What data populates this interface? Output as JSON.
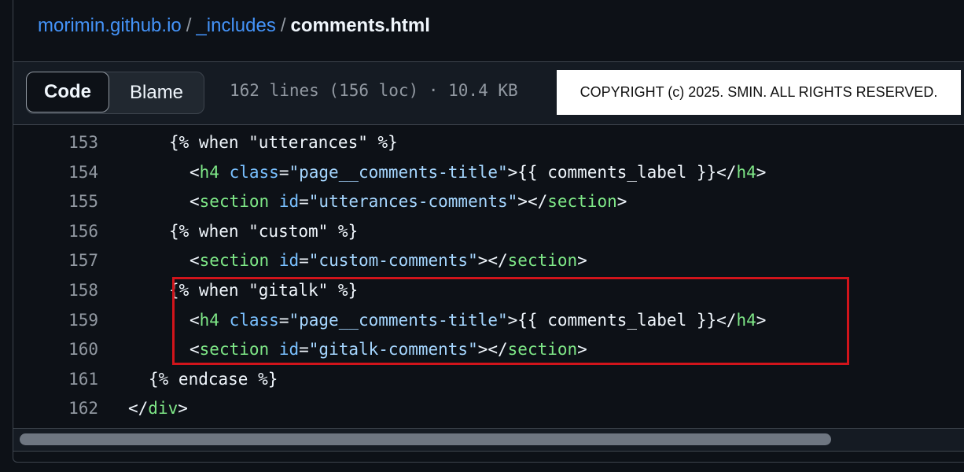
{
  "breadcrumb": {
    "repo": "morimin.github.io",
    "sep1": "/",
    "folder": "_includes",
    "sep2": "/",
    "file": "comments.html"
  },
  "toolbar": {
    "code_label": "Code",
    "blame_label": "Blame",
    "file_info": "162 lines (156 loc) · 10.4 KB"
  },
  "copyright": "COPYRIGHT (c) 2025. SMIN. ALL RIGHTS RESERVED.",
  "code": {
    "lines": [
      {
        "num": "153",
        "indent": 6,
        "tokens": [
          {
            "t": "punc",
            "v": "{% when \"utterances\" %}"
          }
        ]
      },
      {
        "num": "154",
        "indent": 8,
        "tokens": [
          {
            "t": "punc",
            "v": "<"
          },
          {
            "t": "tag",
            "v": "h4"
          },
          {
            "t": "punc",
            "v": " "
          },
          {
            "t": "attr",
            "v": "class"
          },
          {
            "t": "punc",
            "v": "="
          },
          {
            "t": "str",
            "v": "\"page__comments-title\""
          },
          {
            "t": "punc",
            "v": ">{{ comments_label }}</"
          },
          {
            "t": "tag",
            "v": "h4"
          },
          {
            "t": "punc",
            "v": ">"
          }
        ]
      },
      {
        "num": "155",
        "indent": 8,
        "tokens": [
          {
            "t": "punc",
            "v": "<"
          },
          {
            "t": "tag",
            "v": "section"
          },
          {
            "t": "punc",
            "v": " "
          },
          {
            "t": "attr",
            "v": "id"
          },
          {
            "t": "punc",
            "v": "="
          },
          {
            "t": "str",
            "v": "\"utterances-comments\""
          },
          {
            "t": "punc",
            "v": "></"
          },
          {
            "t": "tag",
            "v": "section"
          },
          {
            "t": "punc",
            "v": ">"
          }
        ]
      },
      {
        "num": "156",
        "indent": 6,
        "tokens": [
          {
            "t": "punc",
            "v": "{% when \"custom\" %}"
          }
        ]
      },
      {
        "num": "157",
        "indent": 8,
        "tokens": [
          {
            "t": "punc",
            "v": "<"
          },
          {
            "t": "tag",
            "v": "section"
          },
          {
            "t": "punc",
            "v": " "
          },
          {
            "t": "attr",
            "v": "id"
          },
          {
            "t": "punc",
            "v": "="
          },
          {
            "t": "str",
            "v": "\"custom-comments\""
          },
          {
            "t": "punc",
            "v": "></"
          },
          {
            "t": "tag",
            "v": "section"
          },
          {
            "t": "punc",
            "v": ">"
          }
        ]
      },
      {
        "num": "158",
        "indent": 6,
        "tokens": [
          {
            "t": "punc",
            "v": "{% when \"gitalk\" %}"
          }
        ]
      },
      {
        "num": "159",
        "indent": 8,
        "tokens": [
          {
            "t": "punc",
            "v": "<"
          },
          {
            "t": "tag",
            "v": "h4"
          },
          {
            "t": "punc",
            "v": " "
          },
          {
            "t": "attr",
            "v": "class"
          },
          {
            "t": "punc",
            "v": "="
          },
          {
            "t": "str",
            "v": "\"page__comments-title\""
          },
          {
            "t": "punc",
            "v": ">{{ comments_label }}</"
          },
          {
            "t": "tag",
            "v": "h4"
          },
          {
            "t": "punc",
            "v": ">"
          }
        ]
      },
      {
        "num": "160",
        "indent": 8,
        "tokens": [
          {
            "t": "punc",
            "v": "<"
          },
          {
            "t": "tag",
            "v": "section"
          },
          {
            "t": "punc",
            "v": " "
          },
          {
            "t": "attr",
            "v": "id"
          },
          {
            "t": "punc",
            "v": "="
          },
          {
            "t": "str",
            "v": "\"gitalk-comments\""
          },
          {
            "t": "punc",
            "v": "></"
          },
          {
            "t": "tag",
            "v": "section"
          },
          {
            "t": "punc",
            "v": ">"
          }
        ]
      },
      {
        "num": "161",
        "indent": 4,
        "tokens": [
          {
            "t": "punc",
            "v": "{% endcase %}"
          }
        ]
      },
      {
        "num": "162",
        "indent": 2,
        "tokens": [
          {
            "t": "punc",
            "v": "</"
          },
          {
            "t": "tag",
            "v": "div"
          },
          {
            "t": "punc",
            "v": ">"
          }
        ]
      }
    ]
  },
  "colors": {
    "background": "#0d1117",
    "link": "#4493f8",
    "tag": "#7ee787",
    "attr": "#79c0ff",
    "string": "#a5d6ff",
    "highlight_border": "#d1141b"
  }
}
